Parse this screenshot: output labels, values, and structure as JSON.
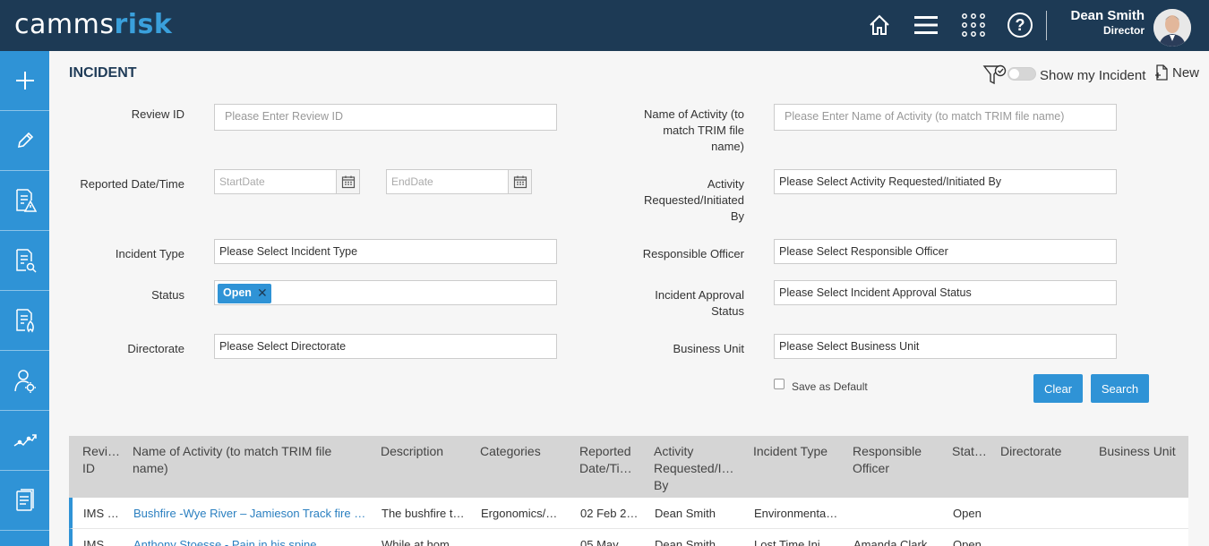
{
  "app": {
    "logo_part1": "camms",
    "logo_part2": "risk"
  },
  "topbar": {
    "icons": [
      "home-icon",
      "menu-icon",
      "apps-grid-icon",
      "help-icon"
    ],
    "user_name": "Dean Smith",
    "user_role": "Director"
  },
  "sidebar": {
    "items": [
      "add-icon",
      "edit-icon",
      "risk-document-icon",
      "review-document-icon",
      "incident-document-icon",
      "user-settings-icon",
      "trend-chart-icon",
      "reports-icon"
    ]
  },
  "header": {
    "title": "INCIDENT",
    "show_my_label": "Show my Incident",
    "new_label": "New"
  },
  "form": {
    "review_id_label": "Review ID",
    "review_id_placeholder": "Please Enter Review ID",
    "reported_label": "Reported Date/Time",
    "start_placeholder": "StartDate",
    "end_placeholder": "EndDate",
    "incident_type_label": "Incident Type",
    "incident_type_value": "Please Select Incident Type",
    "status_label": "Status",
    "status_tag": "Open",
    "directorate_label": "Directorate",
    "directorate_value": "Please Select Directorate",
    "activity_name_label": "Name of Activity (to match TRIM file name)",
    "activity_name_placeholder": "Please Enter Name of Activity (to match TRIM file name)",
    "requested_label": "Activity Requested/Initiated By",
    "requested_value": "Please Select Activity Requested/Initiated By",
    "officer_label": "Responsible Officer",
    "officer_value": "Please Select Responsible Officer",
    "approval_label": "Incident Approval Status",
    "approval_value": "Please Select Incident Approval Status",
    "business_unit_label": "Business Unit",
    "business_unit_value": "Please Select Business Unit",
    "save_default_label": "Save as Default",
    "clear_label": "Clear",
    "search_label": "Search"
  },
  "table": {
    "headers": [
      "Revi… ID",
      "Name of Activity (to match TRIM file name)",
      "Description",
      "Categories",
      "Reported Date/Ti…",
      "Activity Requested/I… By",
      "Incident Type",
      "Responsible Officer",
      "Stat…",
      "Directorate",
      "Business Unit"
    ],
    "rows": [
      [
        "IMS …",
        "Bushfire -Wye River – Jamieson Track fire …",
        "The bushfire t…",
        "Ergonomics/…",
        "02 Feb 2…",
        "Dean Smith",
        "Environmenta…",
        "",
        "Open",
        "",
        ""
      ],
      [
        "IMS …",
        "Anthony Stoesse - Pain in his spine",
        "While at hom…",
        "",
        "05 May …",
        "Dean Smith",
        "Lost Time Inj…",
        "Amanda Clark",
        "Open",
        "",
        ""
      ]
    ]
  }
}
